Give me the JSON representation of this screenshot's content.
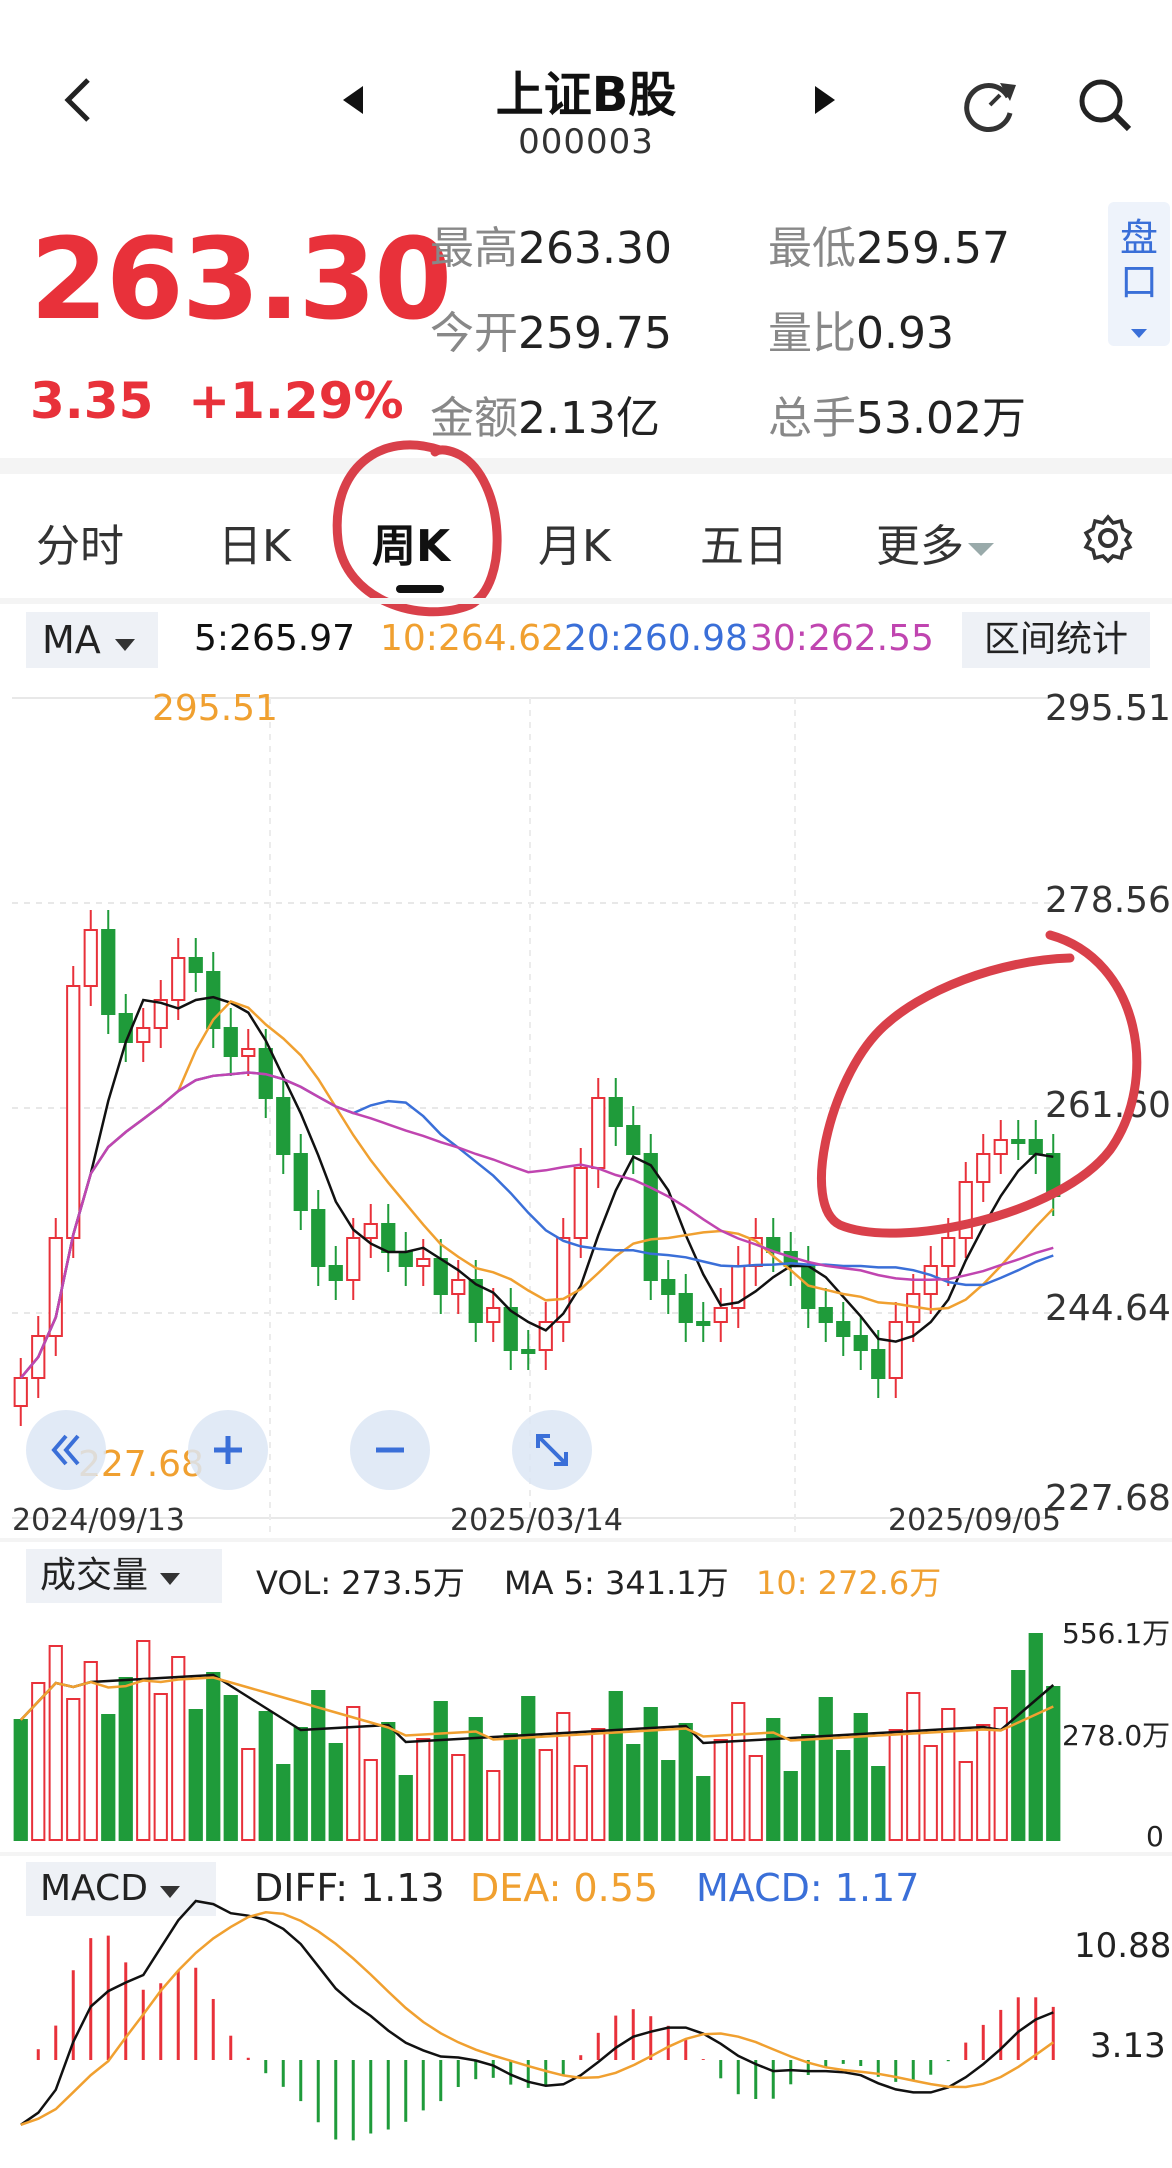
{
  "header": {
    "title": "上证B股",
    "code": "000003",
    "back_icon": "chevron-left-icon",
    "prev_icon": "triangle-left-icon",
    "next_icon": "triangle-right-icon",
    "refresh_icon": "refresh-icon",
    "search_icon": "search-icon"
  },
  "quote": {
    "price": "263.30",
    "change": "3.35",
    "change_pct": "+1.29%",
    "high_label": "最高",
    "high": "263.30",
    "low_label": "最低",
    "low": "259.57",
    "open_label": "今开",
    "open": "259.75",
    "vol_ratio_label": "量比",
    "vol_ratio": "0.93",
    "amount_label": "金额",
    "amount": "2.13亿",
    "turnover_label": "总手",
    "turnover": "53.02万",
    "pan_button": "盘口"
  },
  "tabs": [
    {
      "label": "分时"
    },
    {
      "label": "日K"
    },
    {
      "label": "周K",
      "active": true
    },
    {
      "label": "月K"
    },
    {
      "label": "五日"
    },
    {
      "label": "更多"
    }
  ],
  "settings_icon": "gear-icon",
  "ma_bar": {
    "button": "MA",
    "ma5": "5:265.97",
    "ma10": "10:264.62",
    "ma20": "20:260.98",
    "ma30": "30:262.55",
    "range_button": "区间统计"
  },
  "kline": {
    "y_labels": [
      "295.51",
      "278.56",
      "261.60",
      "244.64",
      "227.68"
    ],
    "max_label": "295.51",
    "min_label": "227.68",
    "x_labels": [
      "2024/09/13",
      "2025/03/14",
      "2025/09/05"
    ]
  },
  "volume": {
    "button": "成交量",
    "vol": "VOL: 273.5万",
    "ma5": "MA 5: 341.1万",
    "ma10": "10: 272.6万",
    "y_labels": [
      "556.1万",
      "278.0万",
      "0"
    ]
  },
  "macd": {
    "button": "MACD",
    "diff": "DIFF: 1.13",
    "dea": "DEA: 0.55",
    "macd": "MACD: 1.17",
    "y_labels": [
      "10.88",
      "3.13"
    ]
  },
  "colors": {
    "up": "#e8313a",
    "down": "#1f9b3a",
    "ma5": "#111111",
    "ma10": "#f0a030",
    "ma20": "#3a6fd8",
    "ma30": "#c045b0",
    "accent": "#3a6fd8"
  }
}
